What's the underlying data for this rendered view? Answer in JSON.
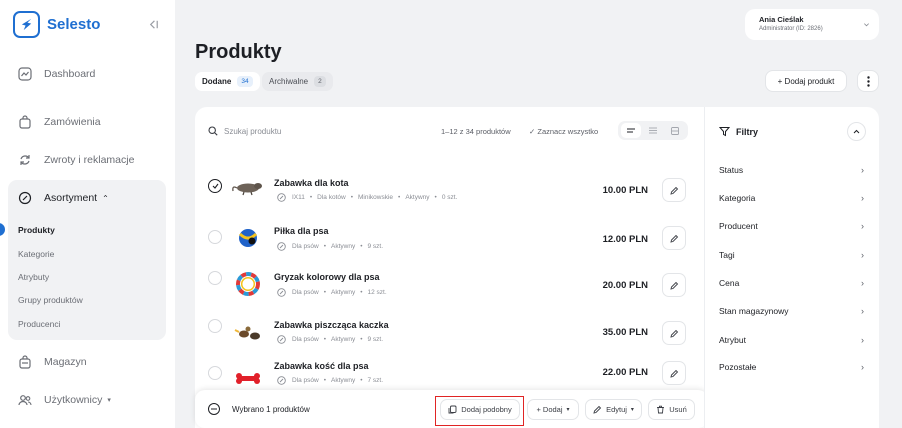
{
  "app": {
    "brand": "Selesto",
    "accent": "#1f6fd1"
  },
  "sidebar": {
    "items": [
      {
        "label": "Dashboard",
        "icon": "chart-icon"
      },
      {
        "label": "Zamówienia",
        "icon": "bag-icon"
      },
      {
        "label": "Zwroty i reklamacje",
        "icon": "refresh-icon"
      }
    ],
    "assortment": {
      "label": "Asortyment",
      "icon": "tag-icon",
      "children": [
        "Produkty",
        "Kategorie",
        "Atrybuty",
        "Grupy produktów",
        "Producenci"
      ],
      "active": "Produkty"
    },
    "bottom_items": [
      {
        "label": "Magazyn",
        "icon": "warehouse-icon"
      },
      {
        "label": "Użytkownicy",
        "icon": "users-icon"
      }
    ]
  },
  "user": {
    "name": "Ania Cieślak",
    "role": "Administrator (ID: 2826)"
  },
  "page": {
    "title": "Produkty",
    "tabs": [
      {
        "label": "Dodane",
        "count": "34",
        "active": true
      },
      {
        "label": "Archiwalne",
        "count": "2",
        "active": false
      }
    ],
    "add_button": "+ Dodaj produkt"
  },
  "list": {
    "search_placeholder": "Szukaj produktu",
    "range": "1–12 z 34 produktów",
    "select_all": "✓ Zaznacz wszystko",
    "products": [
      {
        "name": "Zabawka dla kota",
        "meta": [
          "IX11",
          "Dla kotów",
          "Minikowskie",
          "Aktywny",
          "0 szt."
        ],
        "price": "10.00 PLN",
        "checked": true
      },
      {
        "name": "Piłka dla psa",
        "meta": [
          "Dla psów",
          "Aktywny",
          "9 szt."
        ],
        "price": "12.00 PLN",
        "checked": false
      },
      {
        "name": "Gryzak kolorowy dla psa",
        "meta": [
          "Dla psów",
          "Aktywny",
          "12 szt."
        ],
        "price": "20.00 PLN",
        "checked": false
      },
      {
        "name": "Zabawka piszcząca kaczka",
        "meta": [
          "Dla psów",
          "Aktywny",
          "9 szt."
        ],
        "price": "35.00 PLN",
        "checked": false
      },
      {
        "name": "Zabawka kość dla psa",
        "meta": [
          "Dla psów",
          "Aktywny",
          "7 szt."
        ],
        "price": "22.00 PLN",
        "checked": false
      }
    ]
  },
  "bulk": {
    "label": "Wybrano 1 produktów",
    "actions": {
      "similar": "Dodaj podobny",
      "add": "+ Dodaj",
      "edit": "Edytuj",
      "delete": "Usuń"
    }
  },
  "filters": {
    "title": "Filtry",
    "items": [
      "Status",
      "Kategoria",
      "Producent",
      "Tagi",
      "Cena",
      "Stan magazynowy",
      "Atrybut",
      "Pozostałe"
    ]
  }
}
